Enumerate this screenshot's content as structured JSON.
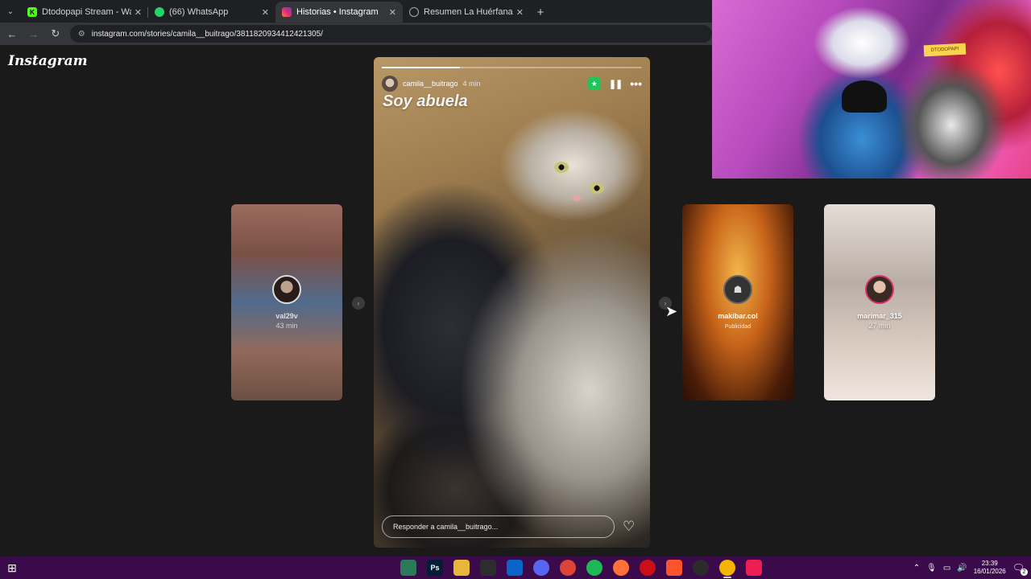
{
  "browser": {
    "tabs": [
      {
        "title": "Dtodopapi Stream - Watch Live",
        "icon": "kick-icon",
        "color": "#53fc18",
        "active": false
      },
      {
        "title": "(66) WhatsApp",
        "icon": "whatsapp-icon",
        "color": "#25d366",
        "active": false
      },
      {
        "title": "Historias • Instagram",
        "icon": "instagram-icon",
        "color": "#e1306c",
        "active": true
      },
      {
        "title": "Resumen La Huérfana",
        "icon": "web-icon",
        "color": "#aaaaaa",
        "active": false
      }
    ],
    "url": "instagram.com/stories/camila__buitrago/3811820934412421305/"
  },
  "page": {
    "logo": "Instagram",
    "main_story": {
      "username": "camila__buitrago",
      "time": "4 min",
      "caption": "Soy abuela",
      "progress": 0.3,
      "reply_placeholder": "Responder a camila__buitrago..."
    },
    "side_stories": [
      {
        "username": "val29v",
        "time": "43 min"
      },
      {
        "username": "makibar.col",
        "time": "Publicidad"
      },
      {
        "username": "marimar_315",
        "time": "27 min"
      }
    ]
  },
  "webcam": {
    "sign_text": "DTODOPAPI"
  },
  "taskbar": {
    "apps": [
      {
        "name": "terminal-app-icon",
        "label": "",
        "color": "#2c7a5a"
      },
      {
        "name": "photoshop-app-icon",
        "label": "Ps",
        "color": "#001e36"
      },
      {
        "name": "file-explorer-app-icon",
        "label": "",
        "color": "#e8b739"
      },
      {
        "name": "store-app-icon",
        "label": "",
        "color": "#2d2d2d"
      },
      {
        "name": "outlook-app-icon",
        "label": "",
        "color": "#0a64c8"
      },
      {
        "name": "discord-app-icon",
        "label": "",
        "color": "#5865f2"
      },
      {
        "name": "chrome-app-icon",
        "label": "",
        "color": "#db4437"
      },
      {
        "name": "spotify-app-icon",
        "label": "",
        "color": "#1db954"
      },
      {
        "name": "firefox-app-icon",
        "label": "",
        "color": "#ff7139"
      },
      {
        "name": "opera-app-icon",
        "label": "",
        "color": "#cc0f16"
      },
      {
        "name": "brave-app-icon",
        "label": "",
        "color": "#fb542b"
      },
      {
        "name": "obs-app-icon",
        "label": "",
        "color": "#2b2b2b"
      },
      {
        "name": "chrome-active-app-icon",
        "label": "",
        "color": "#f4b400"
      },
      {
        "name": "tiktok-app-icon",
        "label": "",
        "color": "#ee1d52"
      }
    ],
    "time": "23:39",
    "date": "16/01/2026",
    "notifications": "2"
  }
}
